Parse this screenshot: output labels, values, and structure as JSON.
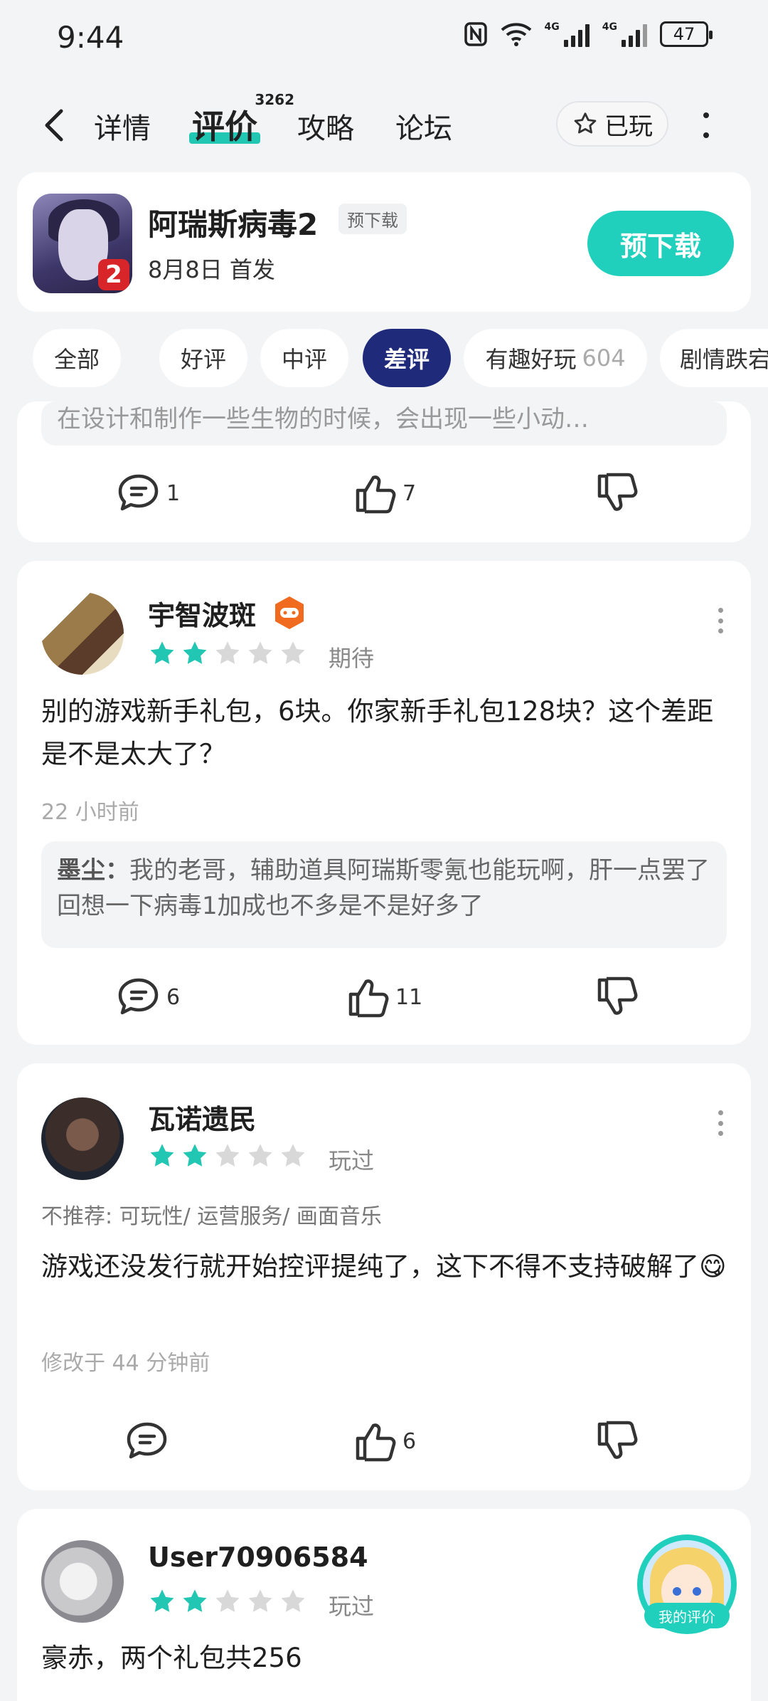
{
  "status": {
    "time": "9:44",
    "battery": "47",
    "net1": "4G",
    "net2": "4G"
  },
  "nav": {
    "tab_detail": "详情",
    "tab_reviews": "评价",
    "review_count": "3262",
    "tab_guides": "攻略",
    "tab_forum": "论坛",
    "played_label": "已玩"
  },
  "game": {
    "name": "阿瑞斯病毒2",
    "tag": "预下载",
    "release": "8月8日 首发",
    "download_label": "预下载",
    "icon_badge": "2"
  },
  "filters": [
    {
      "label": "全部"
    },
    {
      "label": "好评"
    },
    {
      "label": "中评"
    },
    {
      "label": "差评"
    },
    {
      "label": "有趣好玩",
      "count": "604"
    },
    {
      "label": "剧情跌宕"
    }
  ],
  "cards": [
    {
      "quote_partial": "在设计和制作一些生物的时候，会出现一些小动…",
      "comments": "1",
      "likes": "7"
    },
    {
      "user": "宇智波斑",
      "stars": 2,
      "rating_tag": "期待",
      "text": "别的游戏新手礼包，6块。你家新手礼包128块？这个差距是不是太大了？",
      "time": "22 小时前",
      "reply_user": "墨尘：",
      "reply_text": "我的老哥，辅助道具阿瑞斯零氪也能玩啊，肝一点罢了回想一下病毒1加成也不多是不是好多了",
      "comments": "6",
      "likes": "11"
    },
    {
      "user": "瓦诺遗民",
      "stars": 2,
      "rating_tag": "玩过",
      "not_recommend": "不推荐: 可玩性/ 运营服务/ 画面音乐",
      "text": "游戏还没发行就开始控评提纯了，这下不得不支持破解了😋",
      "time": "修改于 44 分钟前",
      "likes": "6"
    },
    {
      "user": "User70906584",
      "stars": 2,
      "rating_tag": "玩过",
      "text": "豪赤，两个礼包共256"
    }
  ],
  "my_review_label": "我的评价",
  "colors": {
    "accent": "#20d0bc",
    "active_chip": "#1f2a7a",
    "star_on": "#22c7b4",
    "star_off": "#d8d8d8"
  }
}
